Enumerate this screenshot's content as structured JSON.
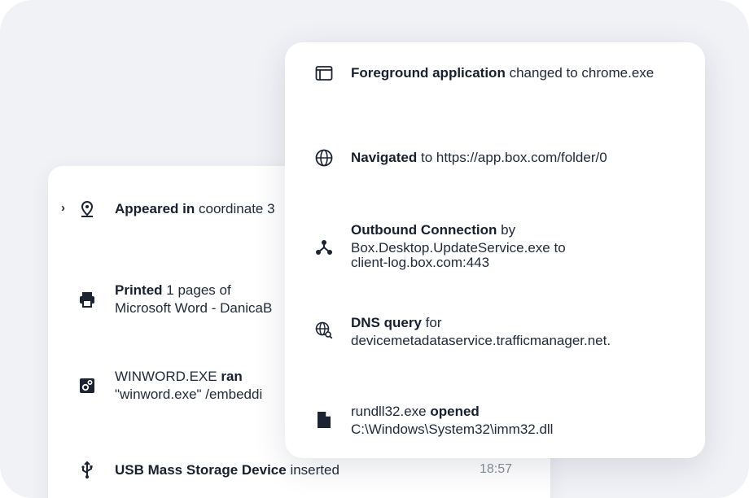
{
  "back_events": [
    {
      "action": "Appeared in",
      "detail": "coordinate 3"
    },
    {
      "action": "Printed",
      "detail": "1 pages of",
      "line2": "Microsoft Word - DanicaB"
    },
    {
      "subject": "WINWORD.EXE",
      "action": "ran",
      "line2": "\"winword.exe\"  /embeddi"
    },
    {
      "action": "USB Mass Storage Device",
      "detail": "inserted",
      "time": "18:57"
    }
  ],
  "front_events": [
    {
      "action": "Foreground application",
      "detail": "changed to chrome.exe"
    },
    {
      "action": "Navigated",
      "detail": "to https://app.box.com/folder/0"
    },
    {
      "action": "Outbound Connection",
      "detail": "by",
      "line2": "Box.Desktop.UpdateService.exe",
      "line2b": "to",
      "line3": "client-log.box.com:443"
    },
    {
      "action": "DNS query",
      "detail": "for",
      "line2": "devicemetadataservice.trafficmanager.net."
    },
    {
      "subject": "rundll32.exe",
      "action": "opened",
      "line2": "C:\\Windows\\System32\\imm32.dll"
    }
  ],
  "icons": {
    "location": "map-pin-icon",
    "print": "printer-icon",
    "process": "gears-icon",
    "usb": "usb-icon",
    "window": "window-icon",
    "globe": "globe-icon",
    "network": "network-nodes-icon",
    "dns": "dns-search-icon",
    "file": "file-icon"
  },
  "colors": {
    "text": "#18202f",
    "muted": "#8a8f99",
    "backdrop": "#f1f2f6"
  }
}
